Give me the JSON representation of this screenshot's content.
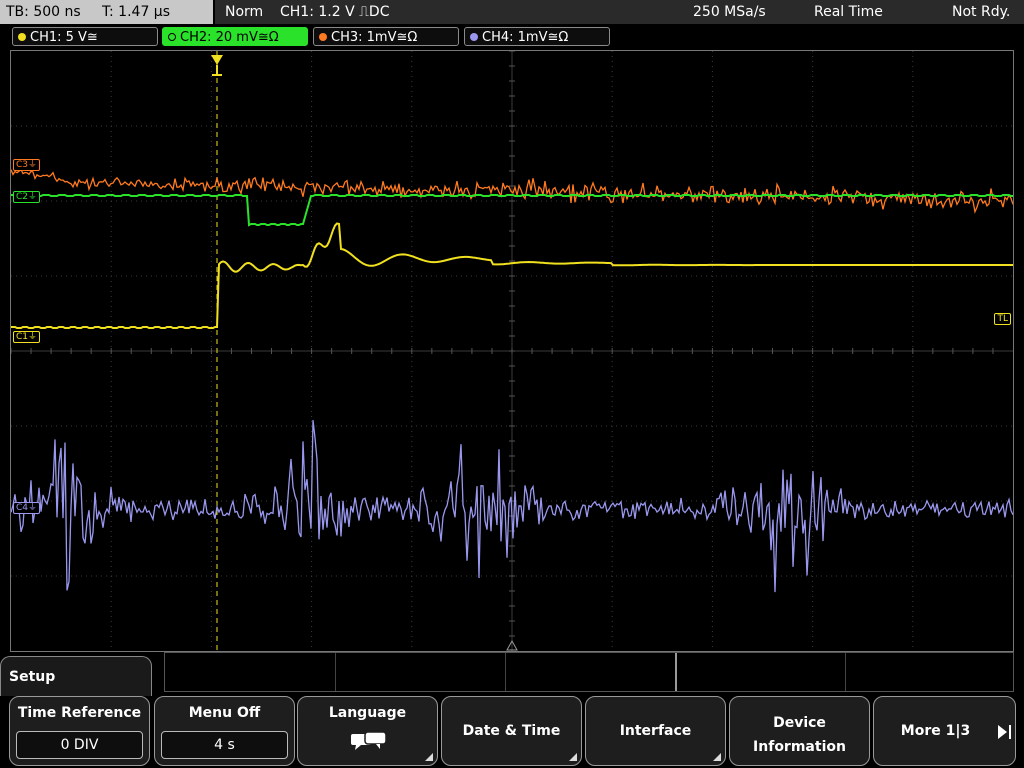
{
  "topbar": {
    "timebase": "TB: 500 ns",
    "trigger_time": "T: 1.47 µs",
    "mode": "Norm",
    "trigger": "CH1: 1.2 V ⎍DC",
    "sample_rate": "250 MSa/s",
    "acq_mode": "Real Time",
    "status": "Not Rdy."
  },
  "channels": [
    {
      "label": "CH1: 5 V≅",
      "color": "#f0e020",
      "active": false
    },
    {
      "label": "CH2: 20 mV≅Ω",
      "color": "#2be22b",
      "active": true
    },
    {
      "label": "CH3: 1mV≅Ω",
      "color": "#ff7a20",
      "active": false
    },
    {
      "label": "CH4: 1mV≅Ω",
      "color": "#9a98ee",
      "active": false
    }
  ],
  "markers": {
    "c1": "C1⏚",
    "c2": "C2⏚",
    "c3": "C3⏚",
    "c4": "C4⏚",
    "tl": "TL"
  },
  "setup_label": "Setup",
  "softkeys": {
    "time_reference": {
      "label": "Time Reference",
      "value": "0 DIV"
    },
    "menu_off": {
      "label": "Menu Off",
      "value": "4 s"
    },
    "language": {
      "label": "Language",
      "icon": "speech-bubbles-icon"
    },
    "date_time": {
      "label": "Date & Time"
    },
    "interface": {
      "label": "Interface"
    },
    "device_info": {
      "line1": "Device",
      "line2": "Information"
    },
    "more": {
      "label": "More 1|3"
    }
  },
  "colors": {
    "ch1": "#f0e020",
    "ch2": "#2be22b",
    "ch3": "#ff7a20",
    "ch4": "#9a98ee",
    "grid": "#3a3a3a",
    "trigger_line": "#f0e020"
  }
}
